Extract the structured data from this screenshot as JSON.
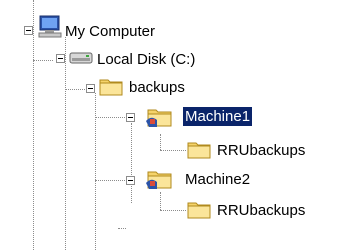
{
  "tree": {
    "nodes": [
      {
        "label": "My Computer",
        "icon": "computer-icon",
        "expanded": true,
        "selected": false
      },
      {
        "label": "Local Disk (C:)",
        "icon": "hard-drive-icon",
        "expanded": true,
        "selected": false
      },
      {
        "label": "backups",
        "icon": "folder-icon",
        "expanded": true,
        "selected": false
      },
      {
        "label": "Machine1",
        "icon": "shared-folder-icon",
        "expanded": true,
        "selected": true
      },
      {
        "label": "RRUbackups",
        "icon": "folder-icon",
        "expanded": false,
        "selected": false
      },
      {
        "label": "Machine2",
        "icon": "shared-folder-icon",
        "expanded": true,
        "selected": false
      },
      {
        "label": "RRUbackups",
        "icon": "folder-icon",
        "expanded": false,
        "selected": false
      }
    ],
    "colors": {
      "selection_bg": "#0a246a",
      "selection_text": "#ffffff",
      "folder": "#f5d36b",
      "dotted_line": "#8c8c8c"
    }
  }
}
